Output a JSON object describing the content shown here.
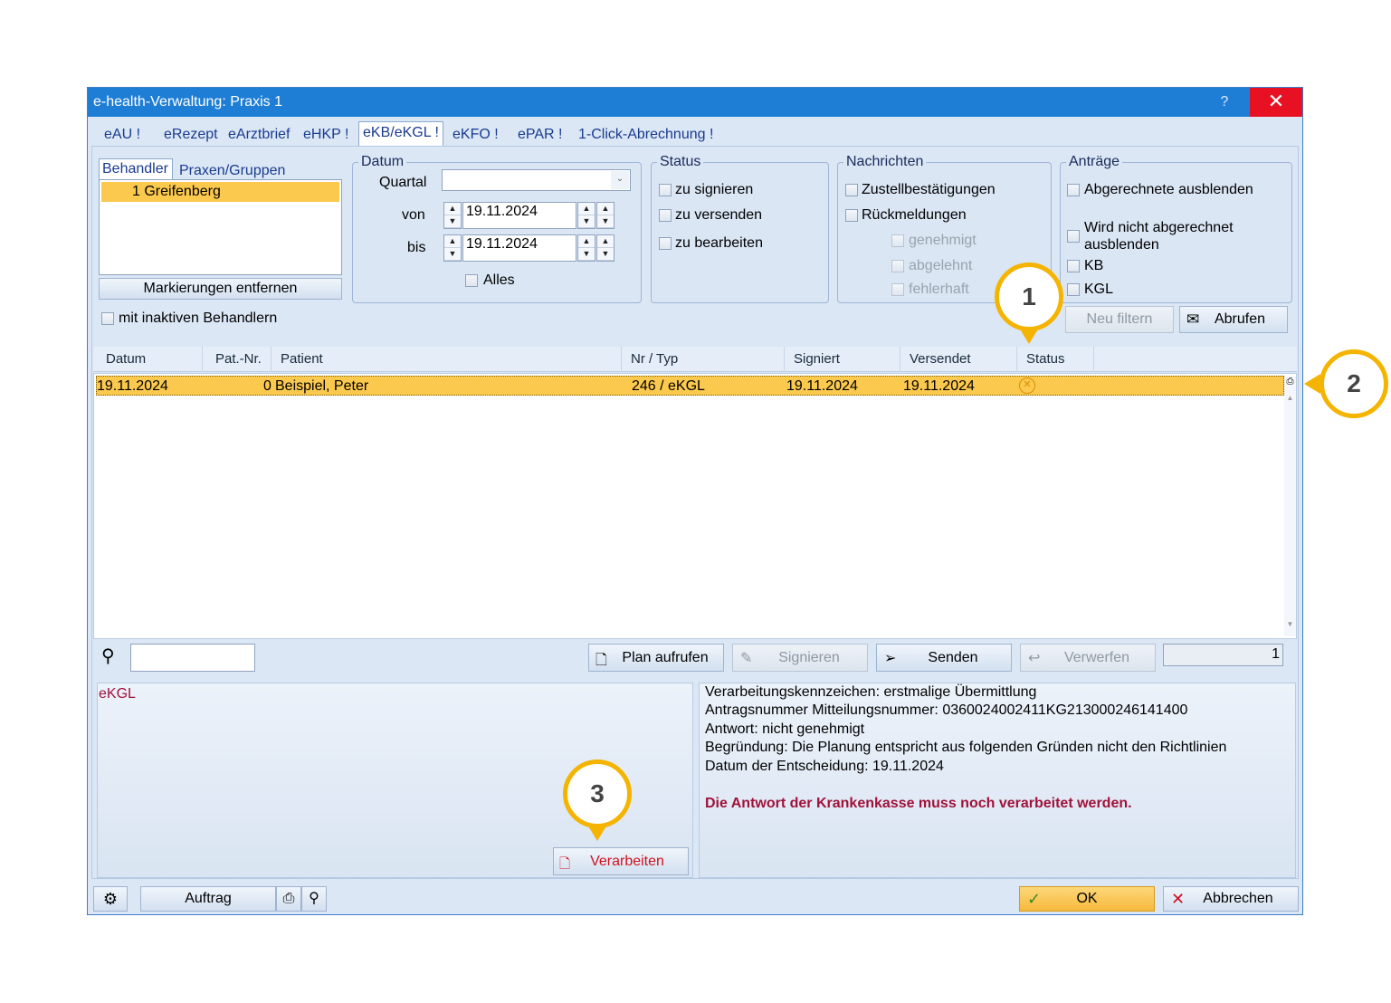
{
  "window": {
    "title": "e-health-Verwaltung: Praxis 1",
    "help": "?",
    "close": "✕"
  },
  "tabs": [
    "eAU !",
    "eRezept",
    "eArztbrief",
    "eHKP !",
    "eKB/eKGL !",
    "eKFO !",
    "ePAR !",
    "1-Click-Abrechnung !"
  ],
  "behandler": {
    "tab1": "Behandler",
    "tab2": "Praxen/Gruppen",
    "selected": "1 Greifenberg",
    "clear_button": "Markierungen entfernen",
    "inactive_label": "mit inaktiven Behandlern"
  },
  "datum": {
    "legend": "Datum",
    "quartal_label": "Quartal",
    "quartal_value": "",
    "von_label": "von",
    "von_value": "19.11.2024",
    "bis_label": "bis",
    "bis_value": "19.11.2024",
    "alles_label": "Alles"
  },
  "status_group": {
    "legend": "Status",
    "opt1": "zu signieren",
    "opt2": "zu versenden",
    "opt3": "zu bearbeiten"
  },
  "nachrichten": {
    "legend": "Nachrichten",
    "opt1": "Zustellbestätigungen",
    "opt2": "Rückmeldungen",
    "sub1": "genehmigt",
    "sub2": "abgelehnt",
    "sub3": "fehlerhaft"
  },
  "antraege": {
    "legend": "Anträge",
    "opt1": "Abgerechnete ausblenden",
    "opt2a": "Wird nicht abgerechnet",
    "opt2b": "ausblenden",
    "opt3": "KB",
    "opt4": "KGL"
  },
  "filter_buttons": {
    "neu_filtern": "Neu filtern",
    "abrufen": "Abrufen"
  },
  "table": {
    "headers": [
      "Datum",
      "Pat.-Nr.",
      "Patient",
      "Nr / Typ",
      "Signiert",
      "Versendet",
      "Status"
    ],
    "rows": [
      {
        "datum": "19.11.2024",
        "patnr": "0",
        "patient": "Beispiel, Peter",
        "nrtyp": "246 / eKGL",
        "signiert": "19.11.2024",
        "versendet": "19.11.2024"
      }
    ]
  },
  "actions": {
    "plan": "Plan aufrufen",
    "signieren": "Signieren",
    "senden": "Senden",
    "verwerfen": "Verwerfen",
    "counter": "1"
  },
  "detail": {
    "type": "eKGL",
    "verarbeiten": "Verarbeiten",
    "lines": [
      "Verarbeitungskennzeichen: erstmalige Übermittlung",
      "Antragsnummer Mitteilungsnummer: 0360024002411KG213000246141400",
      "Antwort: nicht genehmigt",
      "Begründung: Die Planung entspricht aus folgenden Gründen nicht den Richtlinien",
      "Datum der Entscheidung: 19.11.2024"
    ],
    "warning": "Die Antwort der Krankenkasse muss noch verarbeitet werden."
  },
  "footer": {
    "auftrag": "Auftrag",
    "ok": "OK",
    "abbrechen": "Abbrechen"
  },
  "callouts": [
    "1",
    "2",
    "3"
  ],
  "colors": {
    "accent": "#f4b400",
    "selection": "#fcc94f",
    "titlebar": "#1e7ed6",
    "warning": "#a0123a"
  }
}
